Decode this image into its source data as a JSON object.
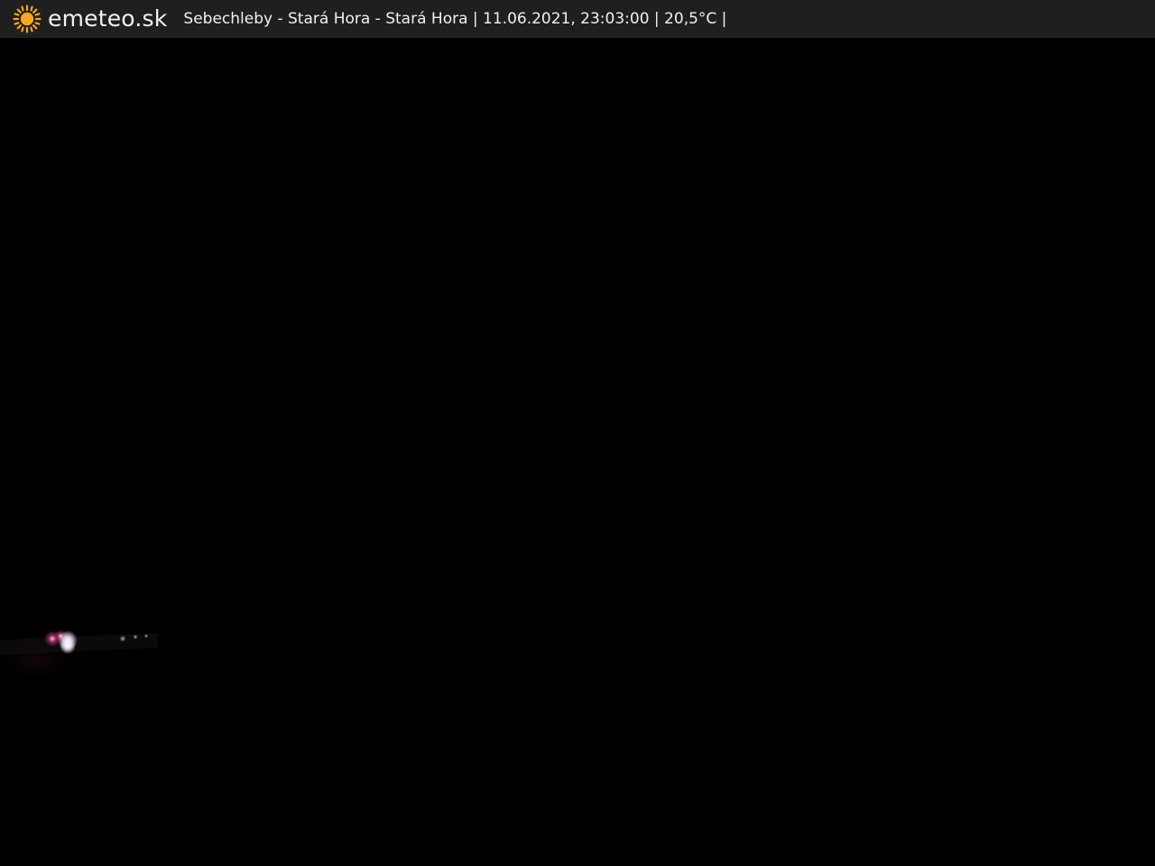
{
  "overlay": {
    "logo_icon": "sun-icon",
    "brand": "emeteo.sk",
    "location": "Sebechleby - Stará Hora - Stará Hora",
    "datetime": "11.06.2021, 23:03:00",
    "temperature": "20,5°C",
    "caption": "Sebechleby - Stará Hora - Stará Hora | 11.06.2021, 23:03:00 | 20,5°C |"
  },
  "colors": {
    "bar_bg": "#1f1f1f",
    "sun": "#f5a623",
    "text": "#f0f0f0",
    "sky": "#000000"
  }
}
